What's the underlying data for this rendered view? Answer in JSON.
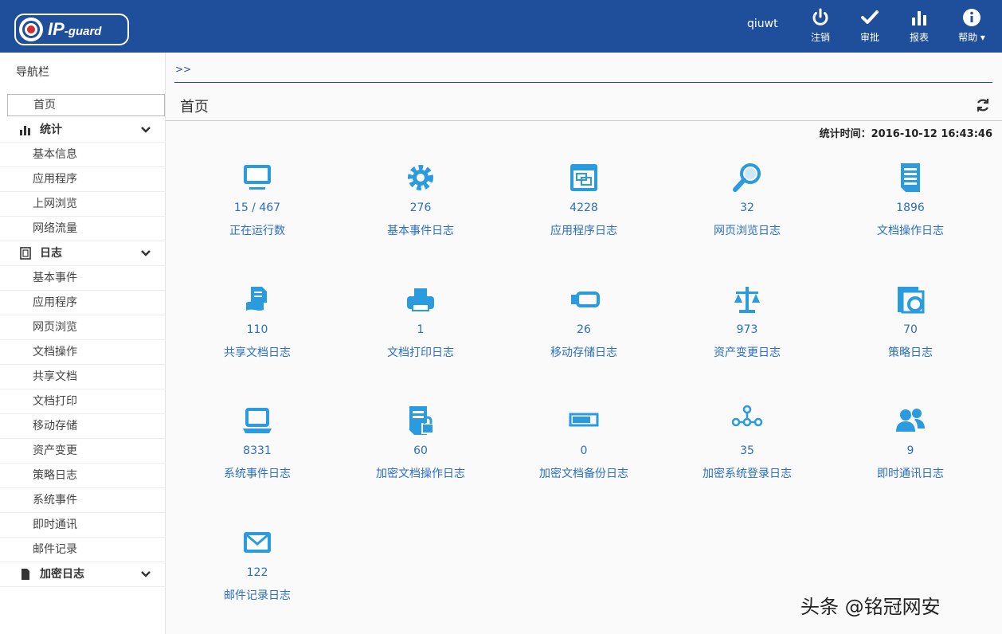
{
  "header": {
    "logo_ip": "IP",
    "logo_guard": "-guard",
    "user": "qiuwt",
    "buttons": [
      {
        "label": "注销",
        "icon": "power-icon"
      },
      {
        "label": "审批",
        "icon": "check-icon"
      },
      {
        "label": "报表",
        "icon": "bar-chart-icon"
      },
      {
        "label": "帮助",
        "icon": "info-icon"
      }
    ]
  },
  "sidebar": {
    "title": "导航栏",
    "home": "首页",
    "groups": [
      {
        "label": "统计",
        "items": [
          "基本信息",
          "应用程序",
          "上网浏览",
          "网络流量"
        ]
      },
      {
        "label": "日志",
        "items": [
          "基本事件",
          "应用程序",
          "网页浏览",
          "文档操作",
          "共享文档",
          "文档打印",
          "移动存储",
          "资产变更",
          "策略日志",
          "系统事件",
          "即时通讯",
          "邮件记录"
        ]
      },
      {
        "label": "加密日志",
        "items": []
      }
    ]
  },
  "main": {
    "breadcrumb": ">>",
    "page_title": "首页",
    "stat_time_label": "统计时间：",
    "stat_time_value": "2016-10-12 16:43:46"
  },
  "tiles": [
    {
      "value": "15 / 467",
      "label": "正在运行数",
      "icon": "monitor-icon"
    },
    {
      "value": "276",
      "label": "基本事件日志",
      "icon": "gear-icon"
    },
    {
      "value": "4228",
      "label": "应用程序日志",
      "icon": "window-icon"
    },
    {
      "value": "32",
      "label": "网页浏览日志",
      "icon": "magnifier-icon"
    },
    {
      "value": "1896",
      "label": "文档操作日志",
      "icon": "document-icon"
    },
    {
      "value": "110",
      "label": "共享文档日志",
      "icon": "share-doc-icon"
    },
    {
      "value": "1",
      "label": "文档打印日志",
      "icon": "printer-icon"
    },
    {
      "value": "26",
      "label": "移动存储日志",
      "icon": "usb-drive-icon"
    },
    {
      "value": "973",
      "label": "资产变更日志",
      "icon": "scale-icon"
    },
    {
      "value": "70",
      "label": "策略日志",
      "icon": "policy-icon"
    },
    {
      "value": "8331",
      "label": "系统事件日志",
      "icon": "laptop-icon"
    },
    {
      "value": "60",
      "label": "加密文档操作日志",
      "icon": "locked-doc-icon"
    },
    {
      "value": "0",
      "label": "加密文档备份日志",
      "icon": "backup-bar-icon"
    },
    {
      "value": "35",
      "label": "加密系统登录日志",
      "icon": "network-icon"
    },
    {
      "value": "9",
      "label": "即时通讯日志",
      "icon": "users-icon"
    },
    {
      "value": "122",
      "label": "邮件记录日志",
      "icon": "mail-icon"
    }
  ],
  "colors": {
    "header": "#1f4f9a",
    "accent": "#2a6fc2",
    "icon": "#2b9be0"
  },
  "watermark": "头条 @铭冠网安"
}
